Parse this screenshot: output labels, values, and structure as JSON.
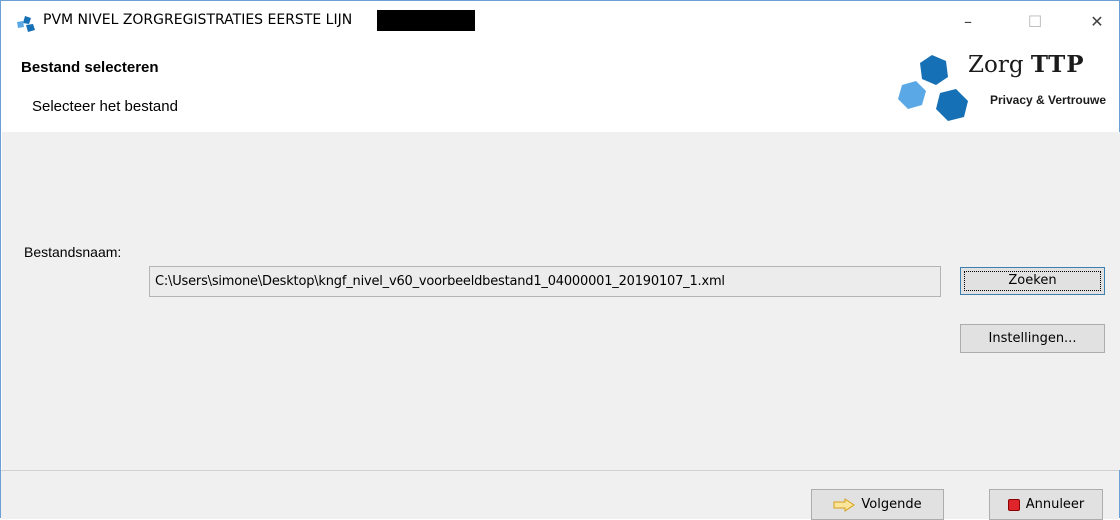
{
  "window": {
    "title": "PVM NIVEL ZORGREGISTRATIES EERSTE LIJN",
    "controls": {
      "minimize": "–",
      "maximize": "☐",
      "close": "✕"
    }
  },
  "header": {
    "title": "Bestand selecteren",
    "subtitle": "Selecteer het bestand"
  },
  "logo": {
    "name_part1": "Zorg",
    "name_part2": "TTP",
    "tagline": "Privacy & Vertrouwe",
    "colors": {
      "dark_blue": "#1670b5",
      "light_blue": "#5aa9e6"
    }
  },
  "form": {
    "file_label": "Bestandsnaam:",
    "file_path": "C:\\Users\\simone\\Desktop\\kngf_nivel_v60_voorbeeldbestand1_04000001_20190107_1.xml",
    "search_button": "Zoeken",
    "settings_button": "Instellingen..."
  },
  "footer": {
    "next_button": "Volgende",
    "cancel_button": "Annuleer",
    "next_icon": "arrow-right-icon",
    "cancel_icon": "stop-icon"
  },
  "colors": {
    "panel_bg": "#f0f0f0",
    "button_bg": "#e1e1e1",
    "focus_border": "#3c7fb1",
    "stop_red": "#e0242b",
    "arrow_yellow": "#f3c53b"
  }
}
